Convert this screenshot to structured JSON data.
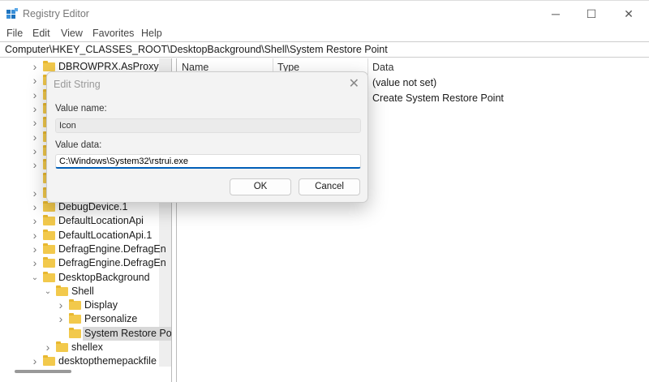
{
  "window": {
    "title": "Registry Editor",
    "minimize": "─",
    "maximize": "☐",
    "close": "✕"
  },
  "menu": [
    "File",
    "Edit",
    "View",
    "Favorites",
    "Help"
  ],
  "address": "Computer\\HKEY_CLASSES_ROOT\\DesktopBackground\\Shell\\System Restore Point",
  "tree": [
    {
      "label": "DBROWPRX.AsProxy",
      "level": 0,
      "state": "collapsed"
    },
    {
      "label": "",
      "level": 0,
      "state": "collapsed"
    },
    {
      "label": "",
      "level": 0,
      "state": "collapsed"
    },
    {
      "label": "",
      "level": 0,
      "state": "collapsed"
    },
    {
      "label": "",
      "level": 0,
      "state": "collapsed"
    },
    {
      "label": "",
      "level": 0,
      "state": "collapsed"
    },
    {
      "label": "",
      "level": 0,
      "state": "collapsed"
    },
    {
      "label": "",
      "level": 0,
      "state": "collapsed"
    },
    {
      "label": "",
      "level": 0,
      "state": "leaf"
    },
    {
      "label": "",
      "level": 0,
      "state": "collapsed"
    },
    {
      "label": "DebugDevice.1",
      "level": 0,
      "state": "collapsed"
    },
    {
      "label": "DefaultLocationApi",
      "level": 0,
      "state": "collapsed"
    },
    {
      "label": "DefaultLocationApi.1",
      "level": 0,
      "state": "collapsed"
    },
    {
      "label": "DefragEngine.DefragEn",
      "level": 0,
      "state": "collapsed"
    },
    {
      "label": "DefragEngine.DefragEn",
      "level": 0,
      "state": "collapsed"
    },
    {
      "label": "DesktopBackground",
      "level": 0,
      "state": "expanded"
    },
    {
      "label": "Shell",
      "level": 1,
      "state": "expanded"
    },
    {
      "label": "Display",
      "level": 2,
      "state": "collapsed"
    },
    {
      "label": "Personalize",
      "level": 2,
      "state": "collapsed"
    },
    {
      "label": "System Restore Po",
      "level": 2,
      "state": "leaf",
      "selected": true
    },
    {
      "label": "shellex",
      "level": 1,
      "state": "collapsed"
    },
    {
      "label": "desktopthemepackfile",
      "level": 0,
      "state": "collapsed"
    }
  ],
  "columns": {
    "name": "Name",
    "type": "Type",
    "data": "Data"
  },
  "values": [
    {
      "data": "(value not set)"
    },
    {
      "data": "Create System Restore Point"
    }
  ],
  "dialog": {
    "title": "Edit String",
    "value_name_label": "Value name:",
    "value_name": "Icon",
    "value_data_label": "Value data:",
    "value_data": "C:\\Windows\\System32\\rstrui.exe",
    "ok": "OK",
    "cancel": "Cancel"
  },
  "colors": {
    "folder": "#f2c94c",
    "accent": "#005fb8"
  }
}
